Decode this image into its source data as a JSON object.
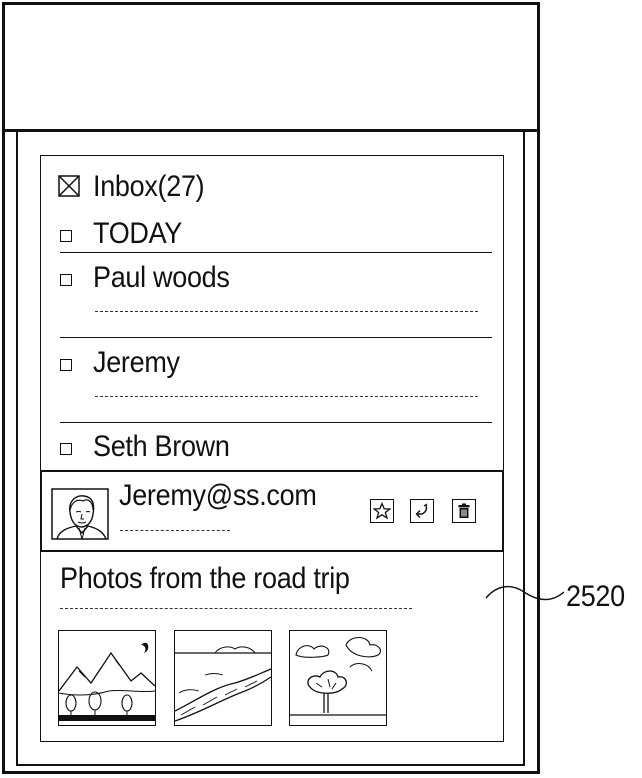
{
  "inbox": {
    "title": "Inbox(27)",
    "section_label": "TODAY",
    "messages": [
      {
        "sender": "Paul woods"
      },
      {
        "sender": "Jeremy"
      },
      {
        "sender": "Seth Brown"
      }
    ]
  },
  "preview": {
    "sender_email": "Jeremy@ss.com",
    "actions": [
      "star-icon",
      "reply-icon",
      "trash-icon"
    ],
    "subject": "Photos from the road trip",
    "attachments": [
      "mountains-photo",
      "river-photo",
      "tree-photo"
    ]
  },
  "reference_numeral": "2520"
}
